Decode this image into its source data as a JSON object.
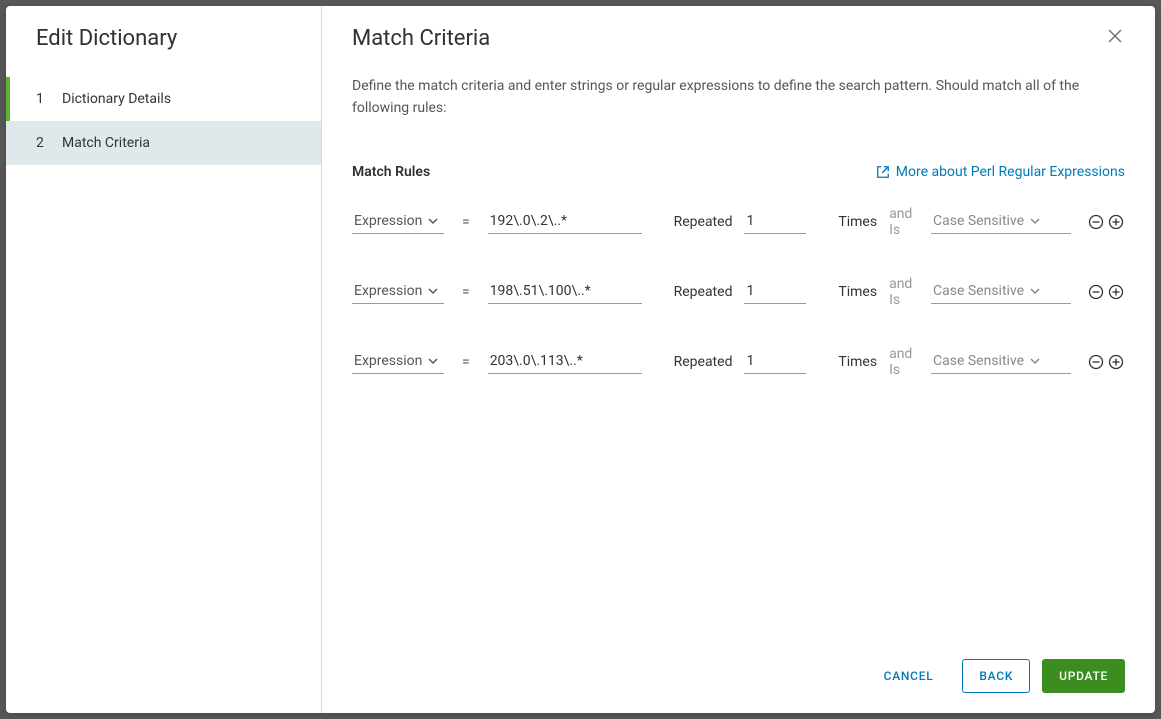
{
  "sidebar": {
    "title": "Edit Dictionary",
    "items": [
      {
        "num": "1",
        "label": "Dictionary Details"
      },
      {
        "num": "2",
        "label": "Match Criteria"
      }
    ]
  },
  "main": {
    "title": "Match Criteria",
    "description": "Define the match criteria and enter strings or regular expressions to define the search pattern. Should match all of the following rules:",
    "rules_header": "Match Rules",
    "help_link": "More about Perl Regular Expressions"
  },
  "labels": {
    "repeated": "Repeated",
    "times": "Times",
    "and_is": "and Is",
    "equals": "="
  },
  "options": {
    "type_label": "Expression",
    "case_label": "Case Sensitive"
  },
  "rules": [
    {
      "value": "192\\.0\\.2\\..*",
      "count": "1"
    },
    {
      "value": "198\\.51\\.100\\..*",
      "count": "1"
    },
    {
      "value": "203\\.0\\.113\\..*",
      "count": "1"
    }
  ],
  "footer": {
    "cancel": "CANCEL",
    "back": "BACK",
    "update": "UPDATE"
  }
}
